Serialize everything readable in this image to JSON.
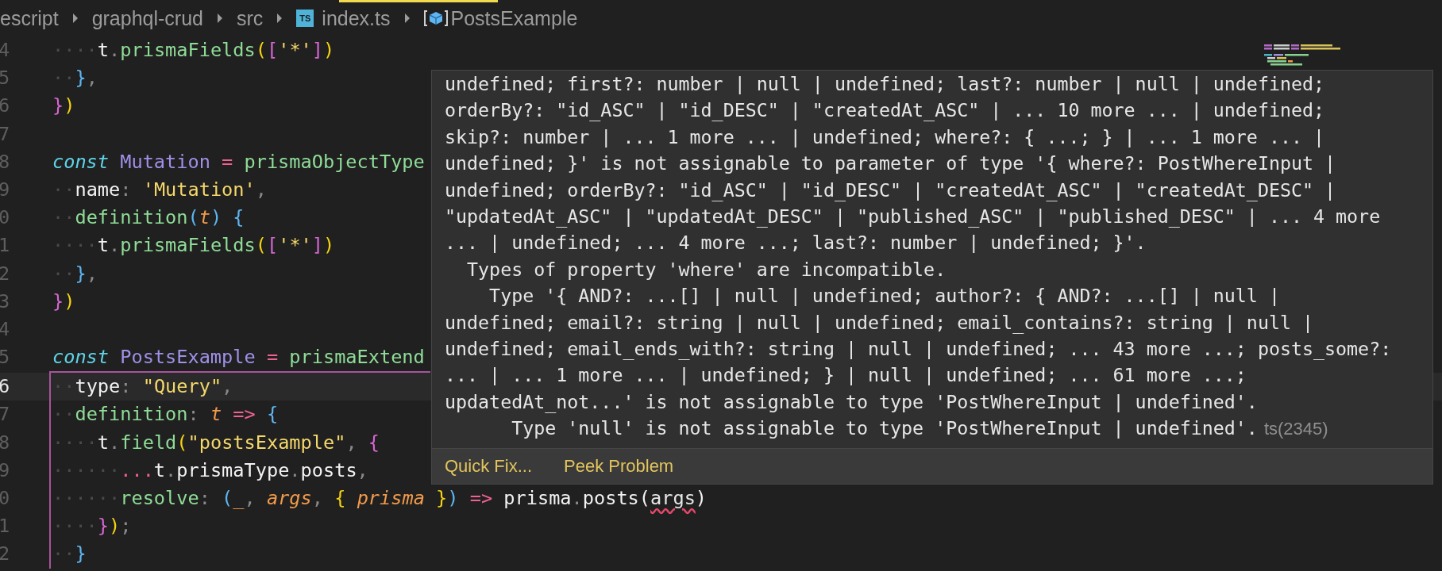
{
  "breadcrumbs": [
    {
      "kind": "folder",
      "label": "escript"
    },
    {
      "kind": "folder",
      "label": "graphql-crud"
    },
    {
      "kind": "folder",
      "label": "src"
    },
    {
      "kind": "file",
      "label": "index.ts",
      "icon_text": "TS"
    },
    {
      "kind": "symbol",
      "label": "PostsExample"
    }
  ],
  "editor": {
    "lines": [
      {
        "number": "4",
        "current": false,
        "boxed": false,
        "tokens": [
          {
            "kind": "ws",
            "text": "····"
          },
          {
            "kind": "id",
            "text": "t"
          },
          {
            "kind": "pun",
            "text": "."
          },
          {
            "kind": "fn",
            "text": "prismaFields"
          },
          {
            "kind": "by",
            "text": "("
          },
          {
            "kind": "bp",
            "text": "["
          },
          {
            "kind": "str",
            "text": "'*'"
          },
          {
            "kind": "bp",
            "text": "]"
          },
          {
            "kind": "by",
            "text": ")"
          }
        ]
      },
      {
        "number": "5",
        "current": false,
        "boxed": false,
        "tokens": [
          {
            "kind": "ws",
            "text": "··"
          },
          {
            "kind": "bb",
            "text": "}"
          },
          {
            "kind": "pun",
            "text": ","
          }
        ]
      },
      {
        "number": "6",
        "current": false,
        "boxed": false,
        "tokens": [
          {
            "kind": "bp",
            "text": "}"
          },
          {
            "kind": "by",
            "text": ")"
          }
        ]
      },
      {
        "number": "7",
        "current": false,
        "boxed": false
      },
      {
        "number": "8",
        "current": false,
        "boxed": false,
        "tokens": [
          {
            "kind": "kw",
            "text": "const"
          },
          {
            "kind": "var",
            "text": " Mutation"
          },
          {
            "kind": "op",
            "text": " = "
          },
          {
            "kind": "fn",
            "text": "prismaObjectType"
          }
        ]
      },
      {
        "number": "9",
        "current": false,
        "boxed": false,
        "tokens": [
          {
            "kind": "ws",
            "text": "··"
          },
          {
            "kind": "id",
            "text": "name"
          },
          {
            "kind": "pun",
            "text": ": "
          },
          {
            "kind": "str",
            "text": "'Mutation'"
          },
          {
            "kind": "pun",
            "text": ","
          }
        ]
      },
      {
        "number": "0",
        "current": false,
        "boxed": false,
        "tokens": [
          {
            "kind": "ws",
            "text": "··"
          },
          {
            "kind": "fn",
            "text": "definition"
          },
          {
            "kind": "bb",
            "text": "("
          },
          {
            "kind": "param",
            "text": "t"
          },
          {
            "kind": "bb",
            "text": ")"
          },
          {
            "kind": "bb",
            "text": " {"
          }
        ]
      },
      {
        "number": "1",
        "current": false,
        "boxed": false,
        "tokens": [
          {
            "kind": "ws",
            "text": "····"
          },
          {
            "kind": "id",
            "text": "t"
          },
          {
            "kind": "pun",
            "text": "."
          },
          {
            "kind": "fn",
            "text": "prismaFields"
          },
          {
            "kind": "by",
            "text": "("
          },
          {
            "kind": "bp",
            "text": "["
          },
          {
            "kind": "str",
            "text": "'*'"
          },
          {
            "kind": "bp",
            "text": "]"
          },
          {
            "kind": "by",
            "text": ")"
          }
        ]
      },
      {
        "number": "2",
        "current": false,
        "boxed": false,
        "tokens": [
          {
            "kind": "ws",
            "text": "··"
          },
          {
            "kind": "bb",
            "text": "}"
          },
          {
            "kind": "pun",
            "text": ","
          }
        ]
      },
      {
        "number": "3",
        "current": false,
        "boxed": false,
        "tokens": [
          {
            "kind": "bp",
            "text": "}"
          },
          {
            "kind": "by",
            "text": ")"
          }
        ]
      },
      {
        "number": "4",
        "current": false,
        "boxed": false
      },
      {
        "number": "5",
        "current": false,
        "boxed": false,
        "tokens": [
          {
            "kind": "kw",
            "text": "const"
          },
          {
            "kind": "var",
            "text": " PostsExample"
          },
          {
            "kind": "op",
            "text": " = "
          },
          {
            "kind": "fn",
            "text": "prismaExtend"
          }
        ]
      },
      {
        "number": "6",
        "current": true,
        "boxed": true,
        "tokens": [
          {
            "kind": "ws",
            "text": "··"
          },
          {
            "kind": "id",
            "text": "type"
          },
          {
            "kind": "pun",
            "text": ": "
          },
          {
            "kind": "str",
            "text": "\"Query\""
          },
          {
            "kind": "pun",
            "text": ","
          }
        ]
      },
      {
        "number": "7",
        "current": false,
        "boxed": true,
        "tokens": [
          {
            "kind": "ws",
            "text": "··"
          },
          {
            "kind": "fn",
            "text": "definition"
          },
          {
            "kind": "pun",
            "text": ": "
          },
          {
            "kind": "param",
            "text": "t"
          },
          {
            "kind": "op",
            "text": " => "
          },
          {
            "kind": "bb",
            "text": "{"
          }
        ]
      },
      {
        "number": "8",
        "current": false,
        "boxed": true,
        "tokens": [
          {
            "kind": "ws",
            "text": "····"
          },
          {
            "kind": "id",
            "text": "t"
          },
          {
            "kind": "pun",
            "text": "."
          },
          {
            "kind": "fn",
            "text": "field"
          },
          {
            "kind": "by",
            "text": "("
          },
          {
            "kind": "str",
            "text": "\"postsExample\""
          },
          {
            "kind": "pun",
            "text": ", "
          },
          {
            "kind": "bp",
            "text": "{"
          }
        ]
      },
      {
        "number": "9",
        "current": false,
        "boxed": true,
        "tokens": [
          {
            "kind": "ws",
            "text": "······"
          },
          {
            "kind": "op",
            "text": "..."
          },
          {
            "kind": "id",
            "text": "t"
          },
          {
            "kind": "pun",
            "text": "."
          },
          {
            "kind": "id",
            "text": "prismaType"
          },
          {
            "kind": "pun",
            "text": "."
          },
          {
            "kind": "id",
            "text": "posts"
          },
          {
            "kind": "pun",
            "text": ","
          }
        ]
      },
      {
        "number": "0",
        "current": false,
        "boxed": true,
        "tokens": [
          {
            "kind": "ws",
            "text": "······"
          },
          {
            "kind": "fn",
            "text": "resolve"
          },
          {
            "kind": "pun",
            "text": ": "
          },
          {
            "kind": "bb",
            "text": "("
          },
          {
            "kind": "paramn",
            "text": "_"
          },
          {
            "kind": "pun",
            "text": ", "
          },
          {
            "kind": "param",
            "text": "args"
          },
          {
            "kind": "pun",
            "text": ", "
          },
          {
            "kind": "by",
            "text": "{ "
          },
          {
            "kind": "param",
            "text": "prisma"
          },
          {
            "kind": "by",
            "text": " }"
          },
          {
            "kind": "bb",
            "text": ")"
          },
          {
            "kind": "op",
            "text": " => "
          },
          {
            "kind": "id",
            "text": "prisma"
          },
          {
            "kind": "pun",
            "text": "."
          },
          {
            "kind": "id",
            "text": "posts"
          },
          {
            "kind": "id",
            "text": "("
          },
          {
            "kind": "err",
            "text": "args"
          },
          {
            "kind": "id",
            "text": ")"
          }
        ]
      },
      {
        "number": "1",
        "current": false,
        "boxed": true,
        "tokens": [
          {
            "kind": "ws",
            "text": "····"
          },
          {
            "kind": "bp",
            "text": "}"
          },
          {
            "kind": "by",
            "text": ")"
          },
          {
            "kind": "pun",
            "text": ";"
          }
        ]
      },
      {
        "number": "2",
        "current": false,
        "boxed": true,
        "tokens": [
          {
            "kind": "ws",
            "text": "··"
          },
          {
            "kind": "bb",
            "text": "}"
          }
        ]
      }
    ]
  },
  "hover": {
    "message_lines": [
      "undefined; first?: number | null | undefined; last?: number | null | undefined;",
      "orderBy?: \"id_ASC\" | \"id_DESC\" | \"createdAt_ASC\" | ... 10 more ... | undefined;",
      "skip?: number | ... 1 more ... | undefined; where?: { ...; } | ... 1 more ... |",
      "undefined; }' is not assignable to parameter of type '{ where?: PostWhereInput |",
      "undefined; orderBy?: \"id_ASC\" | \"id_DESC\" | \"createdAt_ASC\" | \"createdAt_DESC\" |",
      "\"updatedAt_ASC\" | \"updatedAt_DESC\" | \"published_ASC\" | \"published_DESC\" | ... 4 more",
      "... | undefined; ... 4 more ...; last?: number | undefined; }'.",
      "  Types of property 'where' are incompatible.",
      "    Type '{ AND?: ...[] | null | undefined; author?: { AND?: ...[] | null |",
      "undefined; email?: string | null | undefined; email_contains?: string | null |",
      "undefined; email_ends_with?: string | null | undefined; ... 43 more ...; posts_some?:",
      "... | ... 1 more ... | undefined; } | null | undefined; ... 61 more ...;",
      "updatedAt_not...' is not assignable to type 'PostWhereInput | undefined'.",
      "      Type 'null' is not assignable to type 'PostWhereInput | undefined'."
    ],
    "code": "ts(2345)",
    "actions": [
      "Quick Fix...",
      "Peek Problem"
    ]
  }
}
